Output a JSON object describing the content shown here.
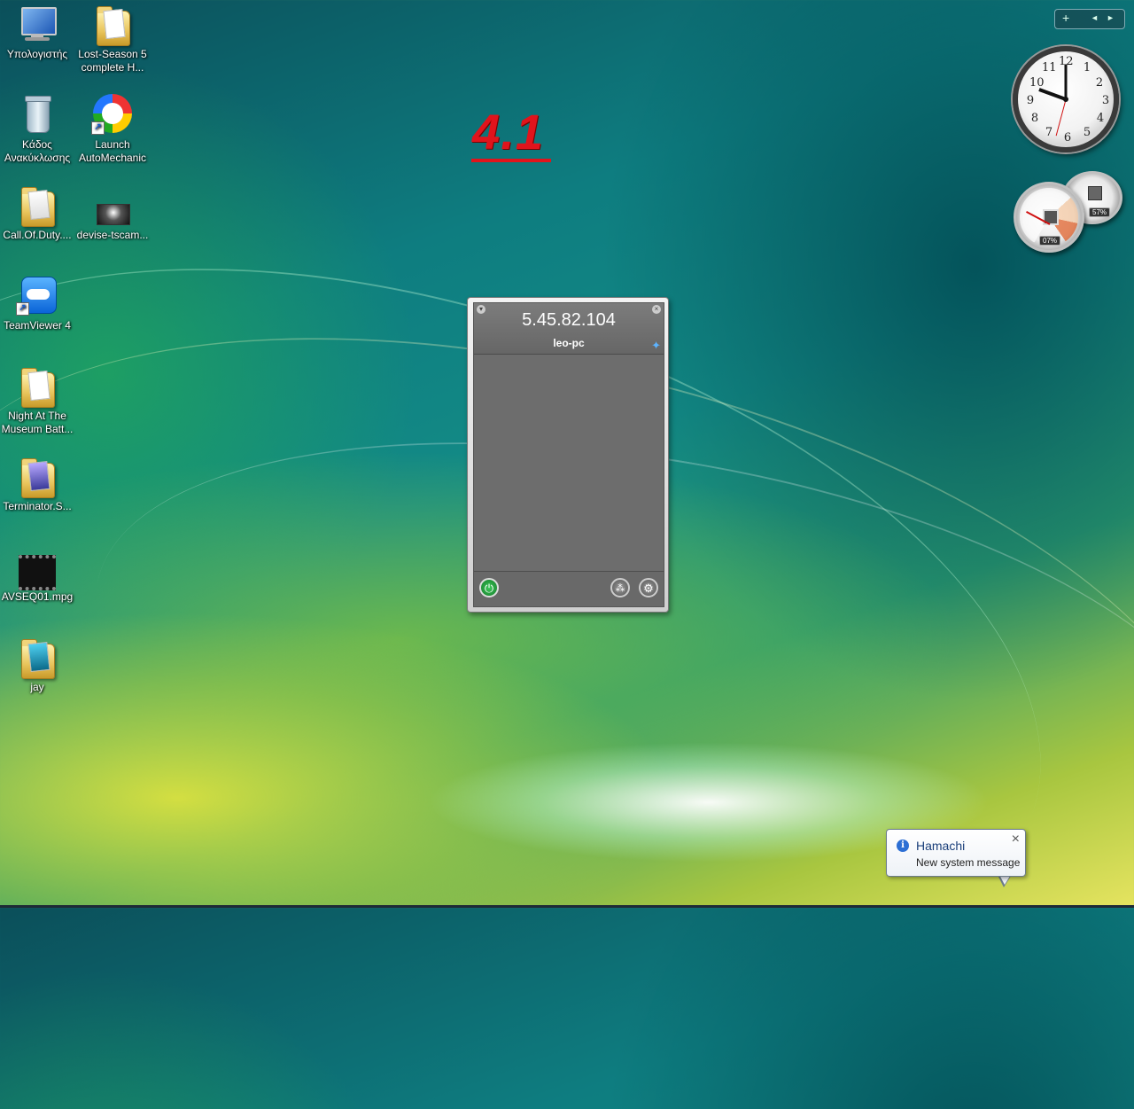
{
  "desktop": {
    "icons": [
      {
        "label": "Υπολογιστής",
        "type": "computer"
      },
      {
        "label": "Lost-Season 5 complete H...",
        "type": "folder"
      },
      {
        "label": "Κάδος Ανακύκλωσης",
        "type": "recycle-bin"
      },
      {
        "label": "Launch AutoMechanic",
        "type": "shortcut"
      },
      {
        "label": "Call.Of.Duty....",
        "type": "folder"
      },
      {
        "label": "devise-tscam...",
        "type": "video"
      },
      {
        "label": "TeamViewer 4",
        "type": "shortcut"
      },
      {
        "label": "Night At The Museum Batt...",
        "type": "folder"
      },
      {
        "label": "Terminator.S...",
        "type": "folder"
      },
      {
        "label": "AVSEQ01.mpg",
        "type": "video"
      },
      {
        "label": "jay",
        "type": "folder"
      }
    ],
    "overlay_text": "4.1"
  },
  "sidebar": {
    "toolbar": {
      "add": "+",
      "prev": "◄",
      "next": "►"
    },
    "clock": {
      "numbers": [
        "12",
        "1",
        "2",
        "3",
        "4",
        "5",
        "6",
        "7",
        "8",
        "9",
        "10",
        "11"
      ]
    },
    "cpu_meter": {
      "cpu_percent": "07%",
      "memory_percent": "57%"
    }
  },
  "hamachi": {
    "ip": "5.45.82.104",
    "name": "leo-pc",
    "accent": "#5db3ff",
    "power_color": "#2da043"
  },
  "notification": {
    "title": "Hamachi",
    "message": "New system message",
    "close": "×",
    "info": "i"
  }
}
